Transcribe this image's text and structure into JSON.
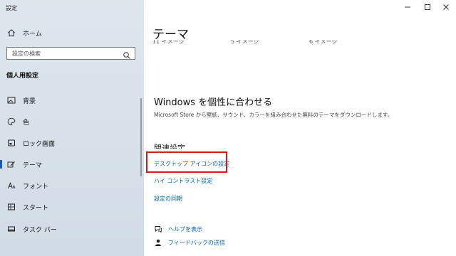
{
  "window": {
    "title": "設定"
  },
  "sidebar": {
    "home": "ホーム",
    "search_placeholder": "設定の検索",
    "section_title": "個人用設定",
    "items": [
      {
        "label": "背景",
        "icon": "picture-icon"
      },
      {
        "label": "色",
        "icon": "palette-icon"
      },
      {
        "label": "ロック画面",
        "icon": "lock-screen-icon"
      },
      {
        "label": "テーマ",
        "icon": "theme-brush-icon",
        "active": true
      },
      {
        "label": "フォント",
        "icon": "font-icon"
      },
      {
        "label": "スタート",
        "icon": "start-grid-icon"
      },
      {
        "label": "タスク バー",
        "icon": "taskbar-icon"
      }
    ]
  },
  "main": {
    "title": "テーマ",
    "theme_thumbs": [
      "11 イメージ",
      "5 イメージ",
      "6 イメージ"
    ],
    "personalize_heading": "Windows を個性に合わせる",
    "personalize_desc": "Microsoft Store から壁紙、サウンド、カラーを組み合わせた無料のテーマをダウンロードします。",
    "related_title": "関連設定",
    "links": [
      "デスクトップ アイコンの設定",
      "ハイ コントラスト設定",
      "設定の同期"
    ],
    "help": [
      {
        "label": "ヘルプを表示",
        "icon": "help-chat-icon"
      },
      {
        "label": "フィードバックの送信",
        "icon": "feedback-person-icon"
      }
    ]
  },
  "colors": {
    "accent": "#0063b1",
    "highlight": "#e0151b",
    "sidebar_bg": "#dbe3ec"
  }
}
